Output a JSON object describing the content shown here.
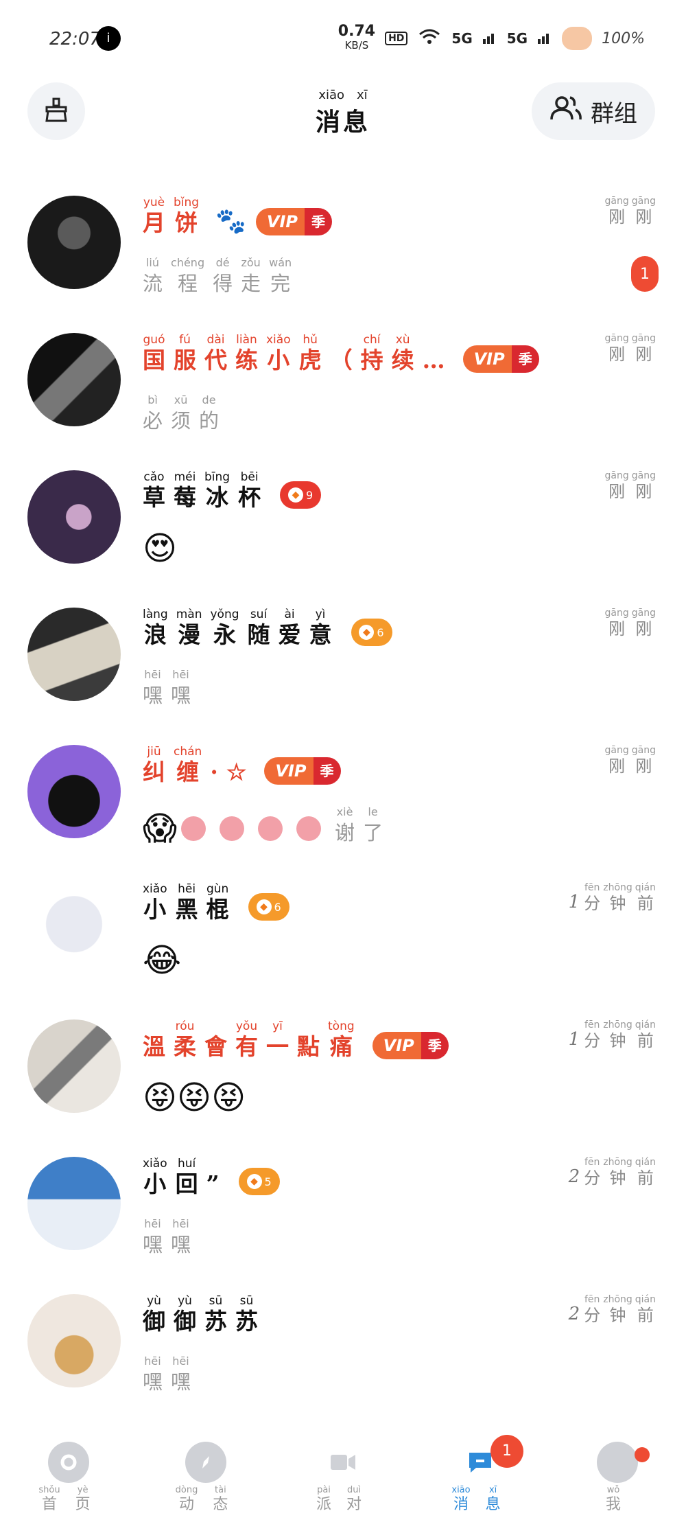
{
  "status_bar": {
    "time": "22:07",
    "notif": "i",
    "speed": "0.74",
    "speed_unit": "KB/S",
    "hd": "HD",
    "sim1": "5G",
    "sim2": "5G",
    "battery": "100%"
  },
  "header": {
    "title_pinyin": [
      "xiāo",
      "xī"
    ],
    "title_han": [
      "消",
      "息"
    ],
    "group_label": "群组"
  },
  "conversations": [
    {
      "name": [
        [
          "yuè",
          "月"
        ],
        [
          "bǐng",
          "饼"
        ]
      ],
      "name_color": "red",
      "extra": "paw",
      "badge_type": "vip",
      "vip_text": "VIP",
      "vip_season": "季",
      "message": [
        [
          "liú",
          "流"
        ],
        [
          "chéng",
          "程"
        ],
        [
          "dé",
          "得"
        ],
        [
          "zǒu",
          "走"
        ],
        [
          "wán",
          "完"
        ]
      ],
      "msg_emoji": "",
      "time_num": "",
      "time": [
        [
          "gāng",
          "刚"
        ],
        [
          "gāng",
          "刚"
        ]
      ],
      "unread": "1"
    },
    {
      "name": [
        [
          "guó",
          "国"
        ],
        [
          "fú",
          "服"
        ],
        [
          "dài",
          "代"
        ],
        [
          "liàn",
          "练"
        ],
        [
          "xiǎo",
          "小"
        ],
        [
          "hǔ",
          "虎"
        ],
        [
          "",
          "（"
        ],
        [
          "chí",
          "持"
        ],
        [
          "xù",
          "续"
        ],
        [
          "",
          "…"
        ]
      ],
      "name_color": "red",
      "extra": "",
      "badge_type": "vip",
      "vip_text": "VIP",
      "vip_season": "季",
      "message": [
        [
          "bì",
          "必"
        ],
        [
          "xū",
          "须"
        ],
        [
          "de",
          "的"
        ]
      ],
      "msg_emoji": "",
      "time_num": "",
      "time": [
        [
          "gāng",
          "刚"
        ],
        [
          "gāng",
          "刚"
        ]
      ],
      "unread": ""
    },
    {
      "name": [
        [
          "cǎo",
          "草"
        ],
        [
          "méi",
          "莓"
        ],
        [
          "bīng",
          "冰"
        ],
        [
          "bēi",
          "杯"
        ]
      ],
      "name_color": "black",
      "extra": "",
      "badge_type": "level-red",
      "level": "9",
      "message": [],
      "msg_emoji": "😍",
      "time_num": "",
      "time": [
        [
          "gāng",
          "刚"
        ],
        [
          "gāng",
          "刚"
        ]
      ],
      "unread": ""
    },
    {
      "name": [
        [
          "làng",
          "浪"
        ],
        [
          "màn",
          "漫"
        ],
        [
          "yǒng",
          "永"
        ],
        [
          "suí",
          "随"
        ],
        [
          "ài",
          "爱"
        ],
        [
          "yì",
          "意"
        ]
      ],
      "name_color": "black",
      "extra": "",
      "badge_type": "level-orange",
      "level": "6",
      "message": [
        [
          "hēi",
          "嘿"
        ],
        [
          "hēi",
          "嘿"
        ]
      ],
      "msg_emoji": "",
      "time_num": "",
      "time": [
        [
          "gāng",
          "刚"
        ],
        [
          "gāng",
          "刚"
        ]
      ],
      "unread": ""
    },
    {
      "name": [
        [
          "jiū",
          "纠"
        ],
        [
          "chán",
          "缠"
        ],
        [
          "",
          "·"
        ],
        [
          "",
          "☆"
        ]
      ],
      "name_color": "red",
      "extra": "",
      "badge_type": "vip",
      "vip_text": "VIP",
      "vip_season": "季",
      "message": [
        [
          "xiè",
          "谢"
        ],
        [
          "le",
          "了"
        ]
      ],
      "msg_emoji": "😱",
      "candies": 4,
      "time_num": "",
      "time": [
        [
          "gāng",
          "刚"
        ],
        [
          "gāng",
          "刚"
        ]
      ],
      "unread": ""
    },
    {
      "name": [
        [
          "xiǎo",
          "小"
        ],
        [
          "hēi",
          "黑"
        ],
        [
          "gùn",
          "棍"
        ]
      ],
      "name_color": "black",
      "extra": "",
      "badge_type": "level-orange",
      "level": "6",
      "message": [],
      "msg_emoji": "😂",
      "time_num": "1",
      "time": [
        [
          "fēn",
          "分"
        ],
        [
          "zhōng",
          "钟"
        ],
        [
          "qián",
          "前"
        ]
      ],
      "unread": ""
    },
    {
      "name": [
        [
          "",
          "溫"
        ],
        [
          "róu",
          "柔"
        ],
        [
          "",
          "會"
        ],
        [
          "yǒu",
          "有"
        ],
        [
          "yī",
          "一"
        ],
        [
          "",
          "點"
        ],
        [
          "tòng",
          "痛"
        ]
      ],
      "name_color": "red",
      "extra": "",
      "badge_type": "vip",
      "vip_text": "VIP",
      "vip_season": "季",
      "message": [],
      "msg_emoji": "😝😝😝",
      "time_num": "1",
      "time": [
        [
          "fēn",
          "分"
        ],
        [
          "zhōng",
          "钟"
        ],
        [
          "qián",
          "前"
        ]
      ],
      "unread": ""
    },
    {
      "name": [
        [
          "xiǎo",
          "小"
        ],
        [
          "huí",
          "回"
        ],
        [
          "",
          "”"
        ]
      ],
      "name_color": "black",
      "extra": "",
      "badge_type": "level-orange",
      "level": "5",
      "message": [
        [
          "hēi",
          "嘿"
        ],
        [
          "hēi",
          "嘿"
        ]
      ],
      "msg_emoji": "",
      "time_num": "2",
      "time": [
        [
          "fēn",
          "分"
        ],
        [
          "zhōng",
          "钟"
        ],
        [
          "qián",
          "前"
        ]
      ],
      "unread": ""
    },
    {
      "name": [
        [
          "yù",
          "御"
        ],
        [
          "yù",
          "御"
        ],
        [
          "sū",
          "苏"
        ],
        [
          "sū",
          "苏"
        ]
      ],
      "name_color": "black",
      "extra": "",
      "badge_type": "none",
      "message": [
        [
          "hēi",
          "嘿"
        ],
        [
          "hēi",
          "嘿"
        ]
      ],
      "msg_emoji": "",
      "time_num": "2",
      "time": [
        [
          "fēn",
          "分"
        ],
        [
          "zhōng",
          "钟"
        ],
        [
          "qián",
          "前"
        ]
      ],
      "unread": ""
    }
  ],
  "tabs": [
    {
      "pinyin": [
        "shǒu",
        "yè"
      ],
      "han": [
        "首",
        "页"
      ],
      "active": false,
      "icon": "home-icon"
    },
    {
      "pinyin": [
        "dòng",
        "tài"
      ],
      "han": [
        "动",
        "态"
      ],
      "active": false,
      "icon": "compass-icon"
    },
    {
      "pinyin": [
        "pài",
        "duì"
      ],
      "han": [
        "派",
        "对"
      ],
      "active": false,
      "icon": "video-icon"
    },
    {
      "pinyin": [
        "xiāo",
        "xī"
      ],
      "han": [
        "消",
        "息"
      ],
      "active": true,
      "icon": "message-icon",
      "badge": "1"
    },
    {
      "pinyin": [
        "wǒ",
        ""
      ],
      "han": [
        "我",
        ""
      ],
      "active": false,
      "icon": "profile-icon",
      "dot": true
    }
  ],
  "colors": {
    "accent_red": "#e3432c",
    "active_blue": "#2e8bd9",
    "badge_red": "#ee4b33"
  }
}
